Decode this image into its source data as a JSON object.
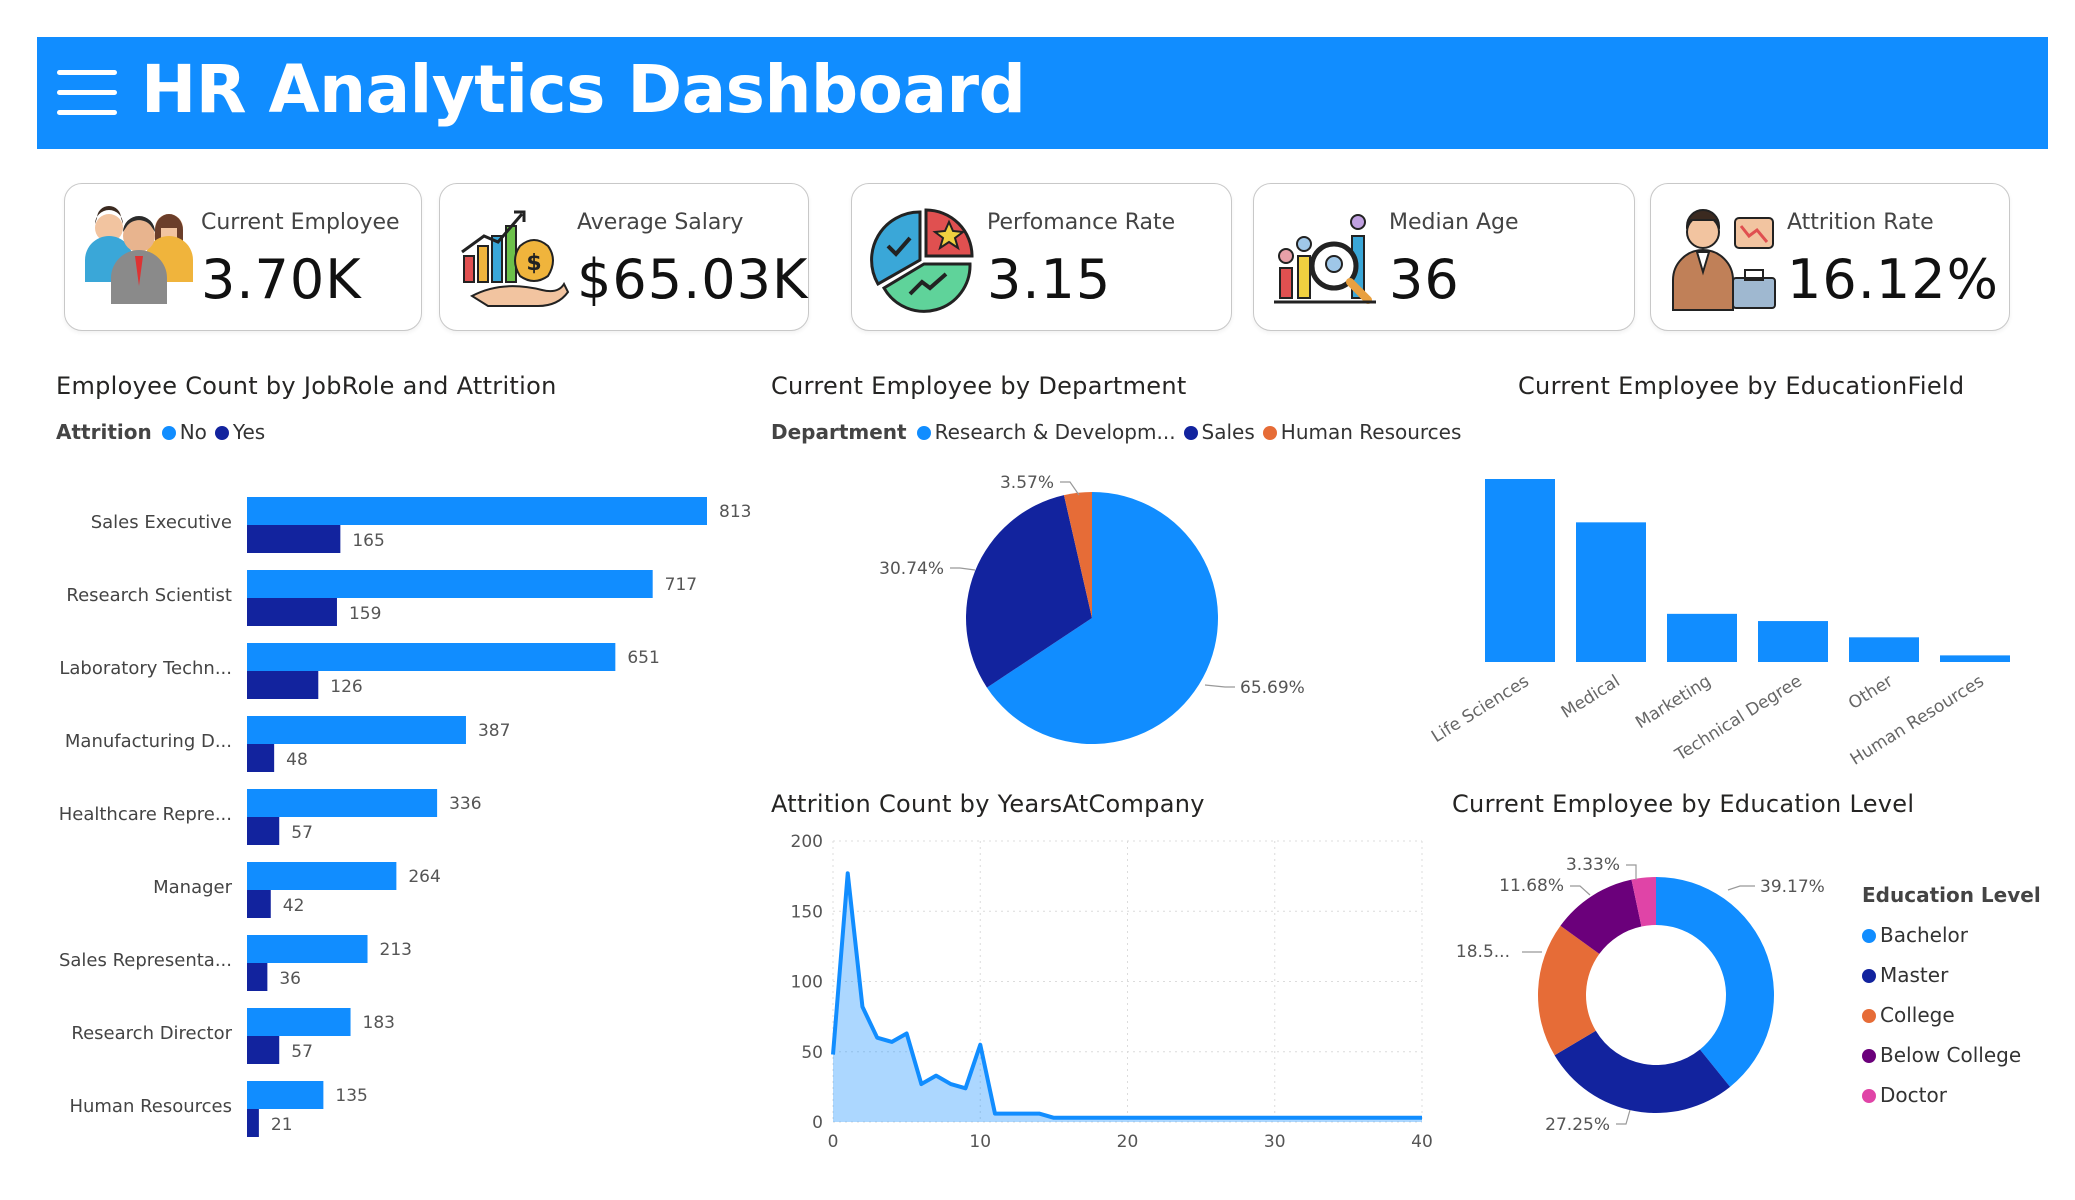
{
  "header": {
    "title": "HR Analytics Dashboard"
  },
  "kpis": {
    "current_employee": {
      "label": "Current Employee",
      "value": "3.70K",
      "icon": "employees-icon"
    },
    "average_salary": {
      "label": "Average Salary",
      "value": "$65.03K",
      "icon": "salary-growth-icon"
    },
    "performance_rate": {
      "label": "Perfomance Rate",
      "value": "3.15",
      "icon": "performance-chart-icon"
    },
    "median_age": {
      "label": "Median Age",
      "value": "36",
      "icon": "age-analytics-icon"
    },
    "attrition_rate": {
      "label": "Attrition Rate",
      "value": "16.12%",
      "icon": "attrition-businessman-icon"
    }
  },
  "colors": {
    "blue": "#118DFF",
    "navy": "#12239E",
    "orange": "#E66C37",
    "purple": "#6B007B",
    "pink": "#E044A7",
    "header": "#118DFF"
  },
  "jobrole": {
    "title": "Employee Count by JobRole and Attrition",
    "legend_title": "Attrition",
    "legend": [
      "No",
      "Yes"
    ]
  },
  "department": {
    "title": "Current Employee by Department",
    "legend_title": "Department",
    "legend": [
      "Research & Developm...",
      "Sales",
      "Human Resources"
    ],
    "labels": [
      "65.69%",
      "30.74%",
      "3.57%"
    ]
  },
  "education_field": {
    "title": "Current Employee by EducationField"
  },
  "years": {
    "title": "Attrition Count by YearsAtCompany"
  },
  "education_level": {
    "title": "Current Employee by Education Level",
    "legend_title": "Education Level",
    "legend": [
      "Bachelor",
      "Master",
      "College",
      "Below College",
      "Doctor"
    ],
    "labels": [
      "39.17%",
      "27.25%",
      "18.5...",
      "11.68%",
      "3.33%"
    ]
  },
  "chart_data": [
    {
      "type": "bar",
      "title": "Employee Count by JobRole and Attrition",
      "orientation": "horizontal",
      "categories": [
        "Sales Executive",
        "Research Scientist",
        "Laboratory Techn...",
        "Manufacturing D...",
        "Healthcare Repre...",
        "Manager",
        "Sales Representa...",
        "Research Director",
        "Human Resources"
      ],
      "series": [
        {
          "name": "No",
          "values": [
            813,
            717,
            651,
            387,
            336,
            264,
            213,
            183,
            135
          ]
        },
        {
          "name": "Yes",
          "values": [
            165,
            159,
            126,
            48,
            57,
            42,
            36,
            57,
            21
          ]
        }
      ],
      "legend": "top-left"
    },
    {
      "type": "pie",
      "title": "Current Employee by Department",
      "categories": [
        "Research & Developm...",
        "Sales",
        "Human Resources"
      ],
      "values": [
        65.69,
        30.74,
        3.57
      ],
      "legend": "top-left"
    },
    {
      "type": "bar",
      "title": "Current Employee by EducationField",
      "categories": [
        "Life Sciences",
        "Medical",
        "Marketing",
        "Technical Degree",
        "Other",
        "Human Resources"
      ],
      "values": [
        1520,
        1160,
        400,
        340,
        205,
        55
      ],
      "grid": false
    },
    {
      "type": "area",
      "title": "Attrition Count by YearsAtCompany",
      "x": [
        0,
        1,
        2,
        3,
        4,
        5,
        6,
        7,
        8,
        9,
        10,
        11,
        12,
        13,
        14,
        15,
        16,
        17,
        18,
        19,
        20,
        21,
        22,
        23,
        24,
        25,
        26,
        27,
        28,
        29,
        30,
        31,
        32,
        33,
        34,
        35,
        36,
        37,
        38,
        39,
        40
      ],
      "values": [
        48,
        177,
        82,
        60,
        57,
        63,
        27,
        33,
        27,
        24,
        55,
        6,
        6,
        6,
        6,
        3,
        3,
        3,
        3,
        3,
        3,
        3,
        3,
        3,
        3,
        3,
        3,
        3,
        3,
        3,
        3,
        3,
        3,
        3,
        3,
        3,
        3,
        3,
        3,
        3,
        3
      ],
      "xticks": [
        "0",
        "10",
        "20",
        "30",
        "40"
      ],
      "yticks": [
        "0",
        "50",
        "100",
        "150",
        "200"
      ],
      "xlim": [
        0,
        40
      ],
      "ylim": [
        0,
        200
      ],
      "grid": true
    },
    {
      "type": "pie",
      "subtype": "donut",
      "title": "Current Employee by Education Level",
      "categories": [
        "Bachelor",
        "Master",
        "College",
        "Below College",
        "Doctor"
      ],
      "values": [
        39.17,
        27.25,
        18.5,
        11.68,
        3.33
      ],
      "legend": "right"
    }
  ]
}
